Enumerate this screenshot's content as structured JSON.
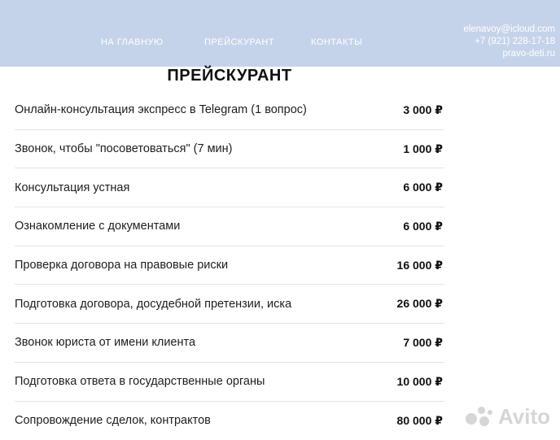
{
  "nav": {
    "home": "НА ГЛАВНУЮ",
    "pricelist": "ПРЕЙСКУРАНТ",
    "contacts": "КОНТАКТЫ"
  },
  "header_contacts": {
    "email": "elenavoy@icloud.com",
    "phone": "+7 (921) 228-17-18",
    "site": "pravo-deti.ru"
  },
  "page_title": "ПРЕЙСКУРАНТ",
  "price_list": [
    {
      "service": "Онлайн-консультация экспресс в Telegram (1 вопрос)",
      "price": "3 000 ₽"
    },
    {
      "service": "Звонок, чтобы \"посоветоваться\" (7 мин)",
      "price": "1 000 ₽"
    },
    {
      "service": "Консультация устная",
      "price": "6 000 ₽"
    },
    {
      "service": "Ознакомление с документами",
      "price": "6 000 ₽"
    },
    {
      "service": "Проверка договора на правовые риски",
      "price": "16 000 ₽"
    },
    {
      "service": "Подготовка договора, досудебной претензии, иска",
      "price": "26 000 ₽"
    },
    {
      "service": "Звонок юриста от имени клиента",
      "price": "7 000 ₽"
    },
    {
      "service": "Подготовка ответа в государственные органы",
      "price": "10 000 ₽"
    },
    {
      "service": "Сопровождение сделок, контрактов",
      "price": "80 000 ₽"
    }
  ],
  "watermark": {
    "text": "Avito",
    "icon": "avito-logo-icon"
  },
  "colors": {
    "header_bg": "#c5d3ea",
    "divider": "#e4e4e4"
  }
}
